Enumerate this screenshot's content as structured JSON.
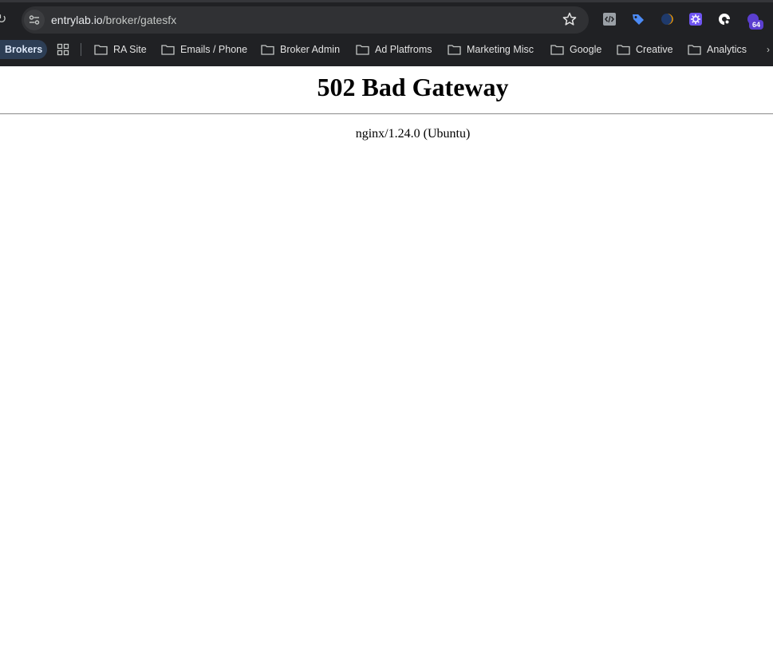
{
  "browser": {
    "url": {
      "domain": "entrylab.io",
      "path": "/broker/gatesfx"
    },
    "extensions": [
      {
        "icon": "code-extension-icon",
        "color": "#9aa0a6"
      },
      {
        "icon": "tag-extension-icon",
        "color": "#4c8bf5"
      },
      {
        "icon": "moon-extension-icon",
        "color": "#f29900"
      },
      {
        "icon": "gear-extension-icon",
        "color": "#6f55f2"
      },
      {
        "icon": "privacy-extension-icon",
        "color": "#ffffff"
      },
      {
        "icon": "badge-extension-icon",
        "color": "#5b3fd0"
      }
    ],
    "extension_badge": "64"
  },
  "bookmarks": {
    "active_group": "Brokers",
    "items": [
      {
        "label": "RA Site"
      },
      {
        "label": "Emails / Phone"
      },
      {
        "label": "Broker Admin"
      },
      {
        "label": "Ad Platfroms"
      },
      {
        "label": "Marketing Misc"
      },
      {
        "label": "Google"
      },
      {
        "label": "Creative"
      },
      {
        "label": "Analytics"
      }
    ]
  },
  "page": {
    "title": "502 Bad Gateway",
    "server": "nginx/1.24.0 (Ubuntu)"
  }
}
